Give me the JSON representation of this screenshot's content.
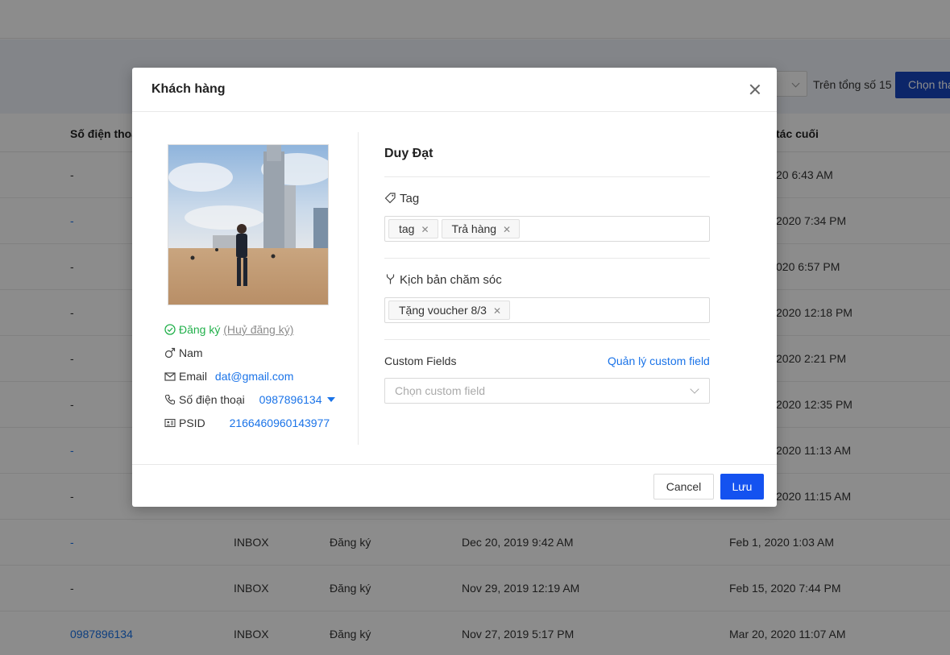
{
  "background": {
    "pager_text": "Trên tổng số 15",
    "select_button": "Chọn tha",
    "headers": [
      "Số điện thoại",
      "tác cuối"
    ],
    "rows": [
      {
        "phone": "-",
        "channel": "",
        "status": "",
        "created": "",
        "last": "20 6:43 AM",
        "phone_link": false
      },
      {
        "phone": "-",
        "channel": "",
        "status": "",
        "created": "",
        "last": "2020 7:34 PM",
        "phone_link": true
      },
      {
        "phone": "-",
        "channel": "",
        "status": "",
        "created": "",
        "last": "020 6:57 PM",
        "phone_link": false
      },
      {
        "phone": "-",
        "channel": "",
        "status": "",
        "created": "",
        "last": "2020 12:18 PM",
        "phone_link": false
      },
      {
        "phone": "-",
        "channel": "",
        "status": "",
        "created": "",
        "last": "2020 2:21 PM",
        "phone_link": false
      },
      {
        "phone": "-",
        "channel": "",
        "status": "",
        "created": "",
        "last": "2020 12:35 PM",
        "phone_link": false
      },
      {
        "phone": "-",
        "channel": "",
        "status": "",
        "created": "",
        "last": "2020 11:13 AM",
        "phone_link": true
      },
      {
        "phone": "-",
        "channel": "",
        "status": "",
        "created": "",
        "last": "2020 11:15 AM",
        "phone_link": false
      },
      {
        "phone": "-",
        "channel": "INBOX",
        "status": "Đăng ký",
        "created": "Dec 20, 2019 9:42 AM",
        "last": "Feb 1, 2020 1:03 AM",
        "phone_link": true
      },
      {
        "phone": "-",
        "channel": "INBOX",
        "status": "Đăng ký",
        "created": "Nov 29, 2019 12:19 AM",
        "last": "Feb 15, 2020 7:44 PM",
        "phone_link": false
      },
      {
        "phone": "0987896134",
        "channel": "INBOX",
        "status": "Đăng ký",
        "created": "Nov 27, 2019 5:17 PM",
        "last": "Mar 20, 2020 11:07 AM",
        "phone_link": true
      }
    ]
  },
  "modal": {
    "title": "Khách hàng",
    "profile": {
      "subscribe_status": "Đăng ký",
      "unsubscribe_link": "(Huỷ đăng ký)",
      "gender": "Nam",
      "email_label": "Email",
      "email": "dat@gmail.com",
      "phone_label": "Số điện thoại",
      "phone": "0987896134",
      "psid_label": "PSID",
      "psid": "2166460960143977"
    },
    "name": "Duy Đạt",
    "tag_label": "Tag",
    "tags": [
      "tag",
      "Trả hàng"
    ],
    "script_label": "Kịch bản chăm sóc",
    "scripts": [
      "Tặng voucher 8/3"
    ],
    "custom_fields_label": "Custom Fields",
    "custom_fields_manage": "Quản lý custom field",
    "custom_field_placeholder": "Chọn custom field",
    "cancel": "Cancel",
    "save": "Lưu"
  },
  "colors": {
    "accent": "#1452f0",
    "link": "#1a73e8",
    "success": "#22b04b"
  }
}
